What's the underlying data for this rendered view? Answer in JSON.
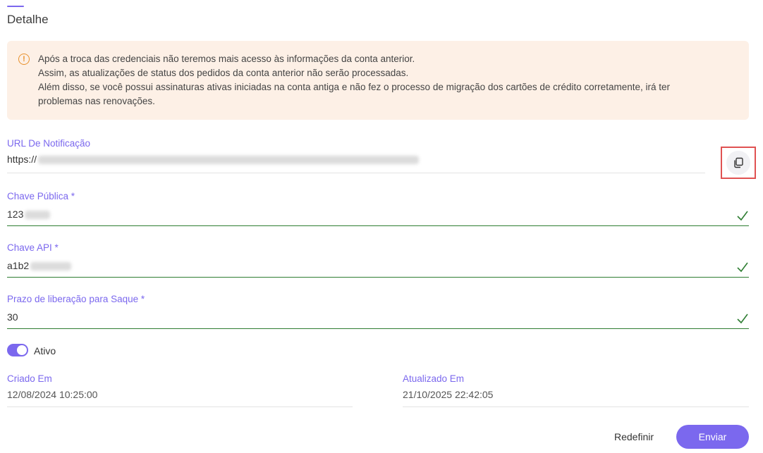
{
  "section": {
    "title": "Detalhe"
  },
  "alert": {
    "lines": [
      "Após a troca das credenciais não teremos mais acesso às informações da conta anterior.",
      "Assim, as atualizações de status dos pedidos da conta anterior não serão processadas.",
      "Além disso, se você possui assinaturas ativas iniciadas na conta antiga e não fez o processo de migração dos cartões de crédito corretamente, irá ter",
      "problemas nas renovações."
    ],
    "icon": "warning-circle-icon",
    "accent_color": "#e8912d"
  },
  "fields": {
    "notification_url": {
      "label": "URL De Notificação",
      "value": "https://"
    },
    "public_key": {
      "label": "Chave Pública *",
      "value": "123"
    },
    "api_key": {
      "label": "Chave API *",
      "value": "a1b2"
    },
    "withdrawal_term": {
      "label": "Prazo de liberação para Saque *",
      "value": "30"
    }
  },
  "toggle": {
    "label": "Ativo",
    "on": true
  },
  "meta": {
    "created_label": "Criado Em",
    "created_value": "12/08/2024 10:25:00",
    "updated_label": "Atualizado Em",
    "updated_value": "21/10/2025 22:42:05"
  },
  "actions": {
    "reset_label": "Redefinir",
    "submit_label": "Enviar"
  },
  "colors": {
    "accent": "#7b68ee",
    "valid": "#2e7d32",
    "highlight": "#e05252"
  }
}
